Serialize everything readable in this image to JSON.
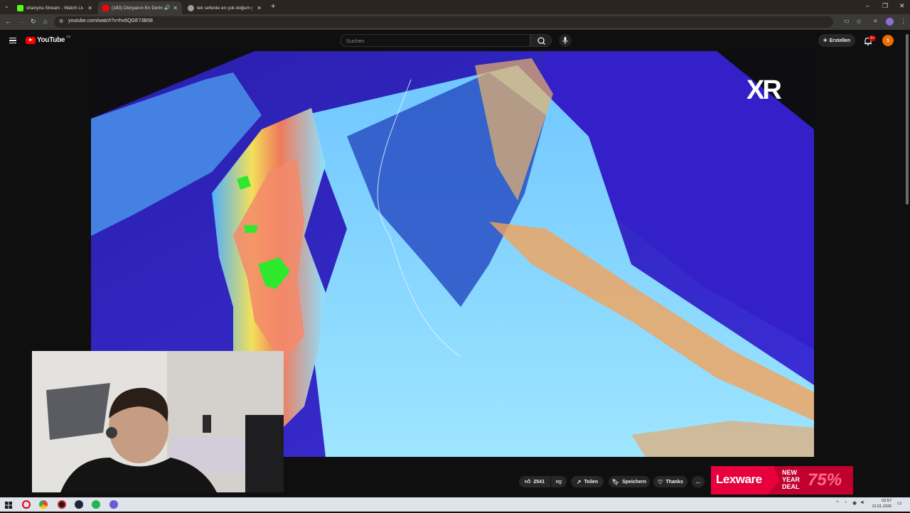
{
  "browser": {
    "tabs": [
      {
        "title": "shanyira Stream - Watch Live o",
        "favicon_color": "#53fc18",
        "active": false
      },
      {
        "title": "(183) Dünyanın En Derin N...",
        "favicon_color": "#ff0000",
        "active": true
      },
      {
        "title": "tek seferde en çok doğum yapa",
        "favicon_color": "#9e9e9e",
        "active": false
      }
    ],
    "new_tab_label": "+",
    "url": "youtube.com/watch?v=hv6QGE73B58",
    "window_controls": {
      "minimize": "–",
      "maximize": "❐",
      "close": "✕"
    }
  },
  "youtube": {
    "logo_text": "YouTube",
    "region": "DE",
    "search_placeholder": "Suchen",
    "create_label": "Erstellen",
    "notification_badge": "9+",
    "avatar_letter": "S",
    "brand_color": "#ff0000"
  },
  "video": {
    "watermark": "XR"
  },
  "actions": {
    "like_count": "2541",
    "share_label": "Teilen",
    "save_label": "Speichern",
    "thanks_label": "Thanks",
    "more_label": "…"
  },
  "ad": {
    "brand": "Lexware",
    "headline_lines": [
      "NEW",
      "YEAR",
      "DEAL"
    ],
    "discount": "75%",
    "color": "#e8003d"
  },
  "taskbar": {
    "time": "02:57",
    "date": "12.01.2026",
    "apps": [
      "windows-start",
      "opera",
      "chrome",
      "app-red",
      "steam",
      "spotify",
      "app-purple"
    ]
  }
}
